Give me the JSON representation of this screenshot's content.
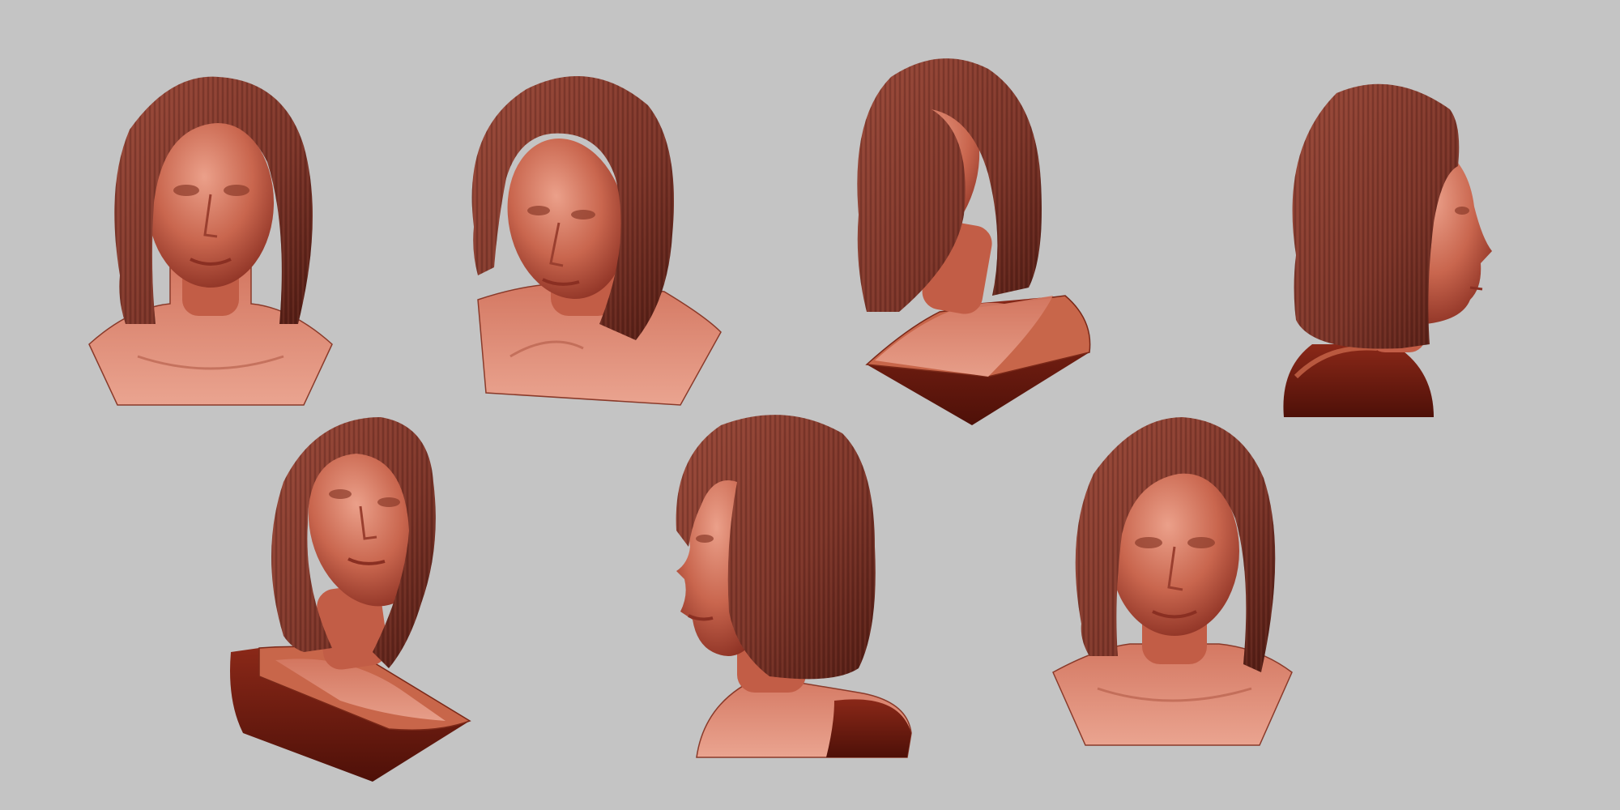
{
  "scene": {
    "background_color": "#c4c4c4",
    "subject": "sculpted-female-bust-with-bob-haircut",
    "material": "clay-matcap",
    "colors": {
      "skin_light": "#e0907a",
      "skin_mid": "#c26048",
      "skin_dark": "#8a2f22",
      "hair": "#7a3428",
      "hair_dark": "#4e1a12",
      "base_top": "#c8664a",
      "base_side": "#6b1a10"
    },
    "views": [
      {
        "id": "front",
        "icon": "bust-front-icon"
      },
      {
        "id": "three-quarter-left-down",
        "icon": "bust-three-quarter-icon"
      },
      {
        "id": "low-angle-left",
        "icon": "bust-low-angle-icon"
      },
      {
        "id": "profile-right",
        "icon": "bust-profile-icon"
      },
      {
        "id": "low-angle-left-tilted",
        "icon": "bust-low-angle-icon"
      },
      {
        "id": "side-left",
        "icon": "bust-side-icon"
      },
      {
        "id": "front-elevated",
        "icon": "bust-front-icon"
      }
    ]
  }
}
